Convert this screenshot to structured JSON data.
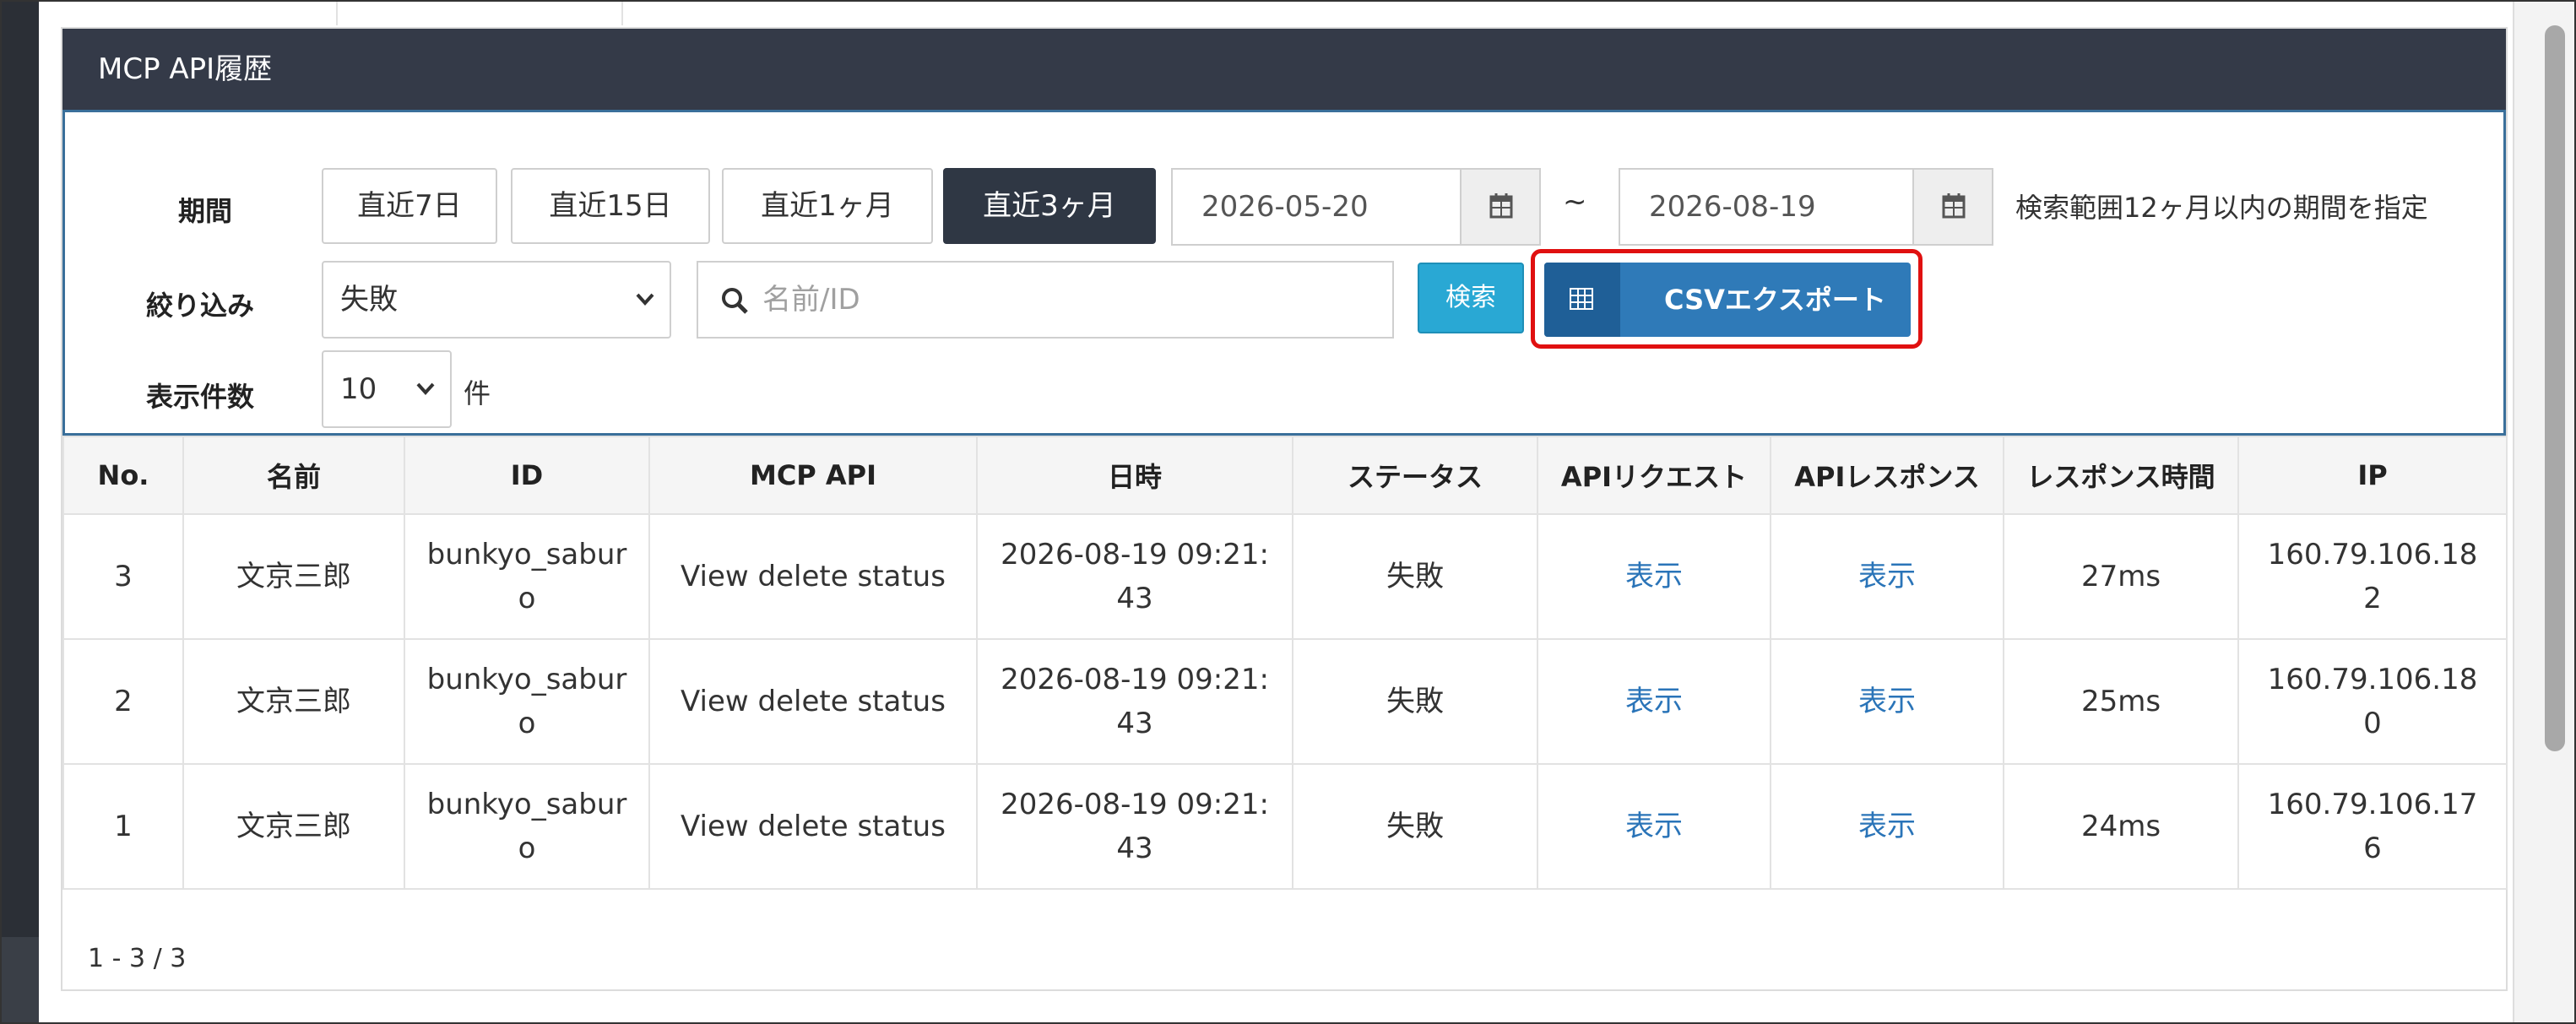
{
  "panel": {
    "title": "MCP API履歴"
  },
  "filters": {
    "period_label": "期間",
    "period_buttons": [
      "直近7日",
      "直近15日",
      "直近1ヶ月",
      "直近3ヶ月"
    ],
    "active_period": "直近3ヶ月",
    "date_from": "2026-05-20",
    "date_to": "2026-08-19",
    "tilde": "~",
    "range_note": "検索範囲12ヶ月以内の期間を指定",
    "filter_label": "絞り込み",
    "filter_value": "失敗",
    "search_placeholder": "名前/ID",
    "search_button": "検索",
    "csv_button": "CSVエクスポート",
    "count_label": "表示件数",
    "count_value": "10",
    "count_unit": "件"
  },
  "table": {
    "headers": [
      "No.",
      "名前",
      "ID",
      "MCP API",
      "日時",
      "ステータス",
      "APIリクエスト",
      "APIレスポンス",
      "レスポンス時間",
      "IP"
    ],
    "rows": [
      [
        "3",
        "文京三郎",
        "bunkyo_saburo",
        "View delete status",
        "2026-08-19 09:21:43",
        "失敗",
        "表示",
        "表示",
        "27ms",
        "160.79.106.182"
      ],
      [
        "2",
        "文京三郎",
        "bunkyo_saburo",
        "View delete status",
        "2026-08-19 09:21:43",
        "失敗",
        "表示",
        "表示",
        "25ms",
        "160.79.106.180"
      ],
      [
        "1",
        "文京三郎",
        "bunkyo_saburo",
        "View delete status",
        "2026-08-19 09:21:43",
        "失敗",
        "表示",
        "表示",
        "24ms",
        "160.79.106.176"
      ]
    ]
  },
  "pagination": {
    "summary": "1 - 3 / 3"
  },
  "colors": {
    "header_bg": "#343a48",
    "active_button": "#2f3744",
    "search_button": "#29a8d4",
    "csv_button": "#2f7ab8",
    "highlight": "#e01010",
    "link": "#2a74b8"
  },
  "icons": {
    "calendar": "calendar-icon",
    "search": "search-icon",
    "chevron": "chevron-down-icon",
    "table": "table-icon"
  }
}
